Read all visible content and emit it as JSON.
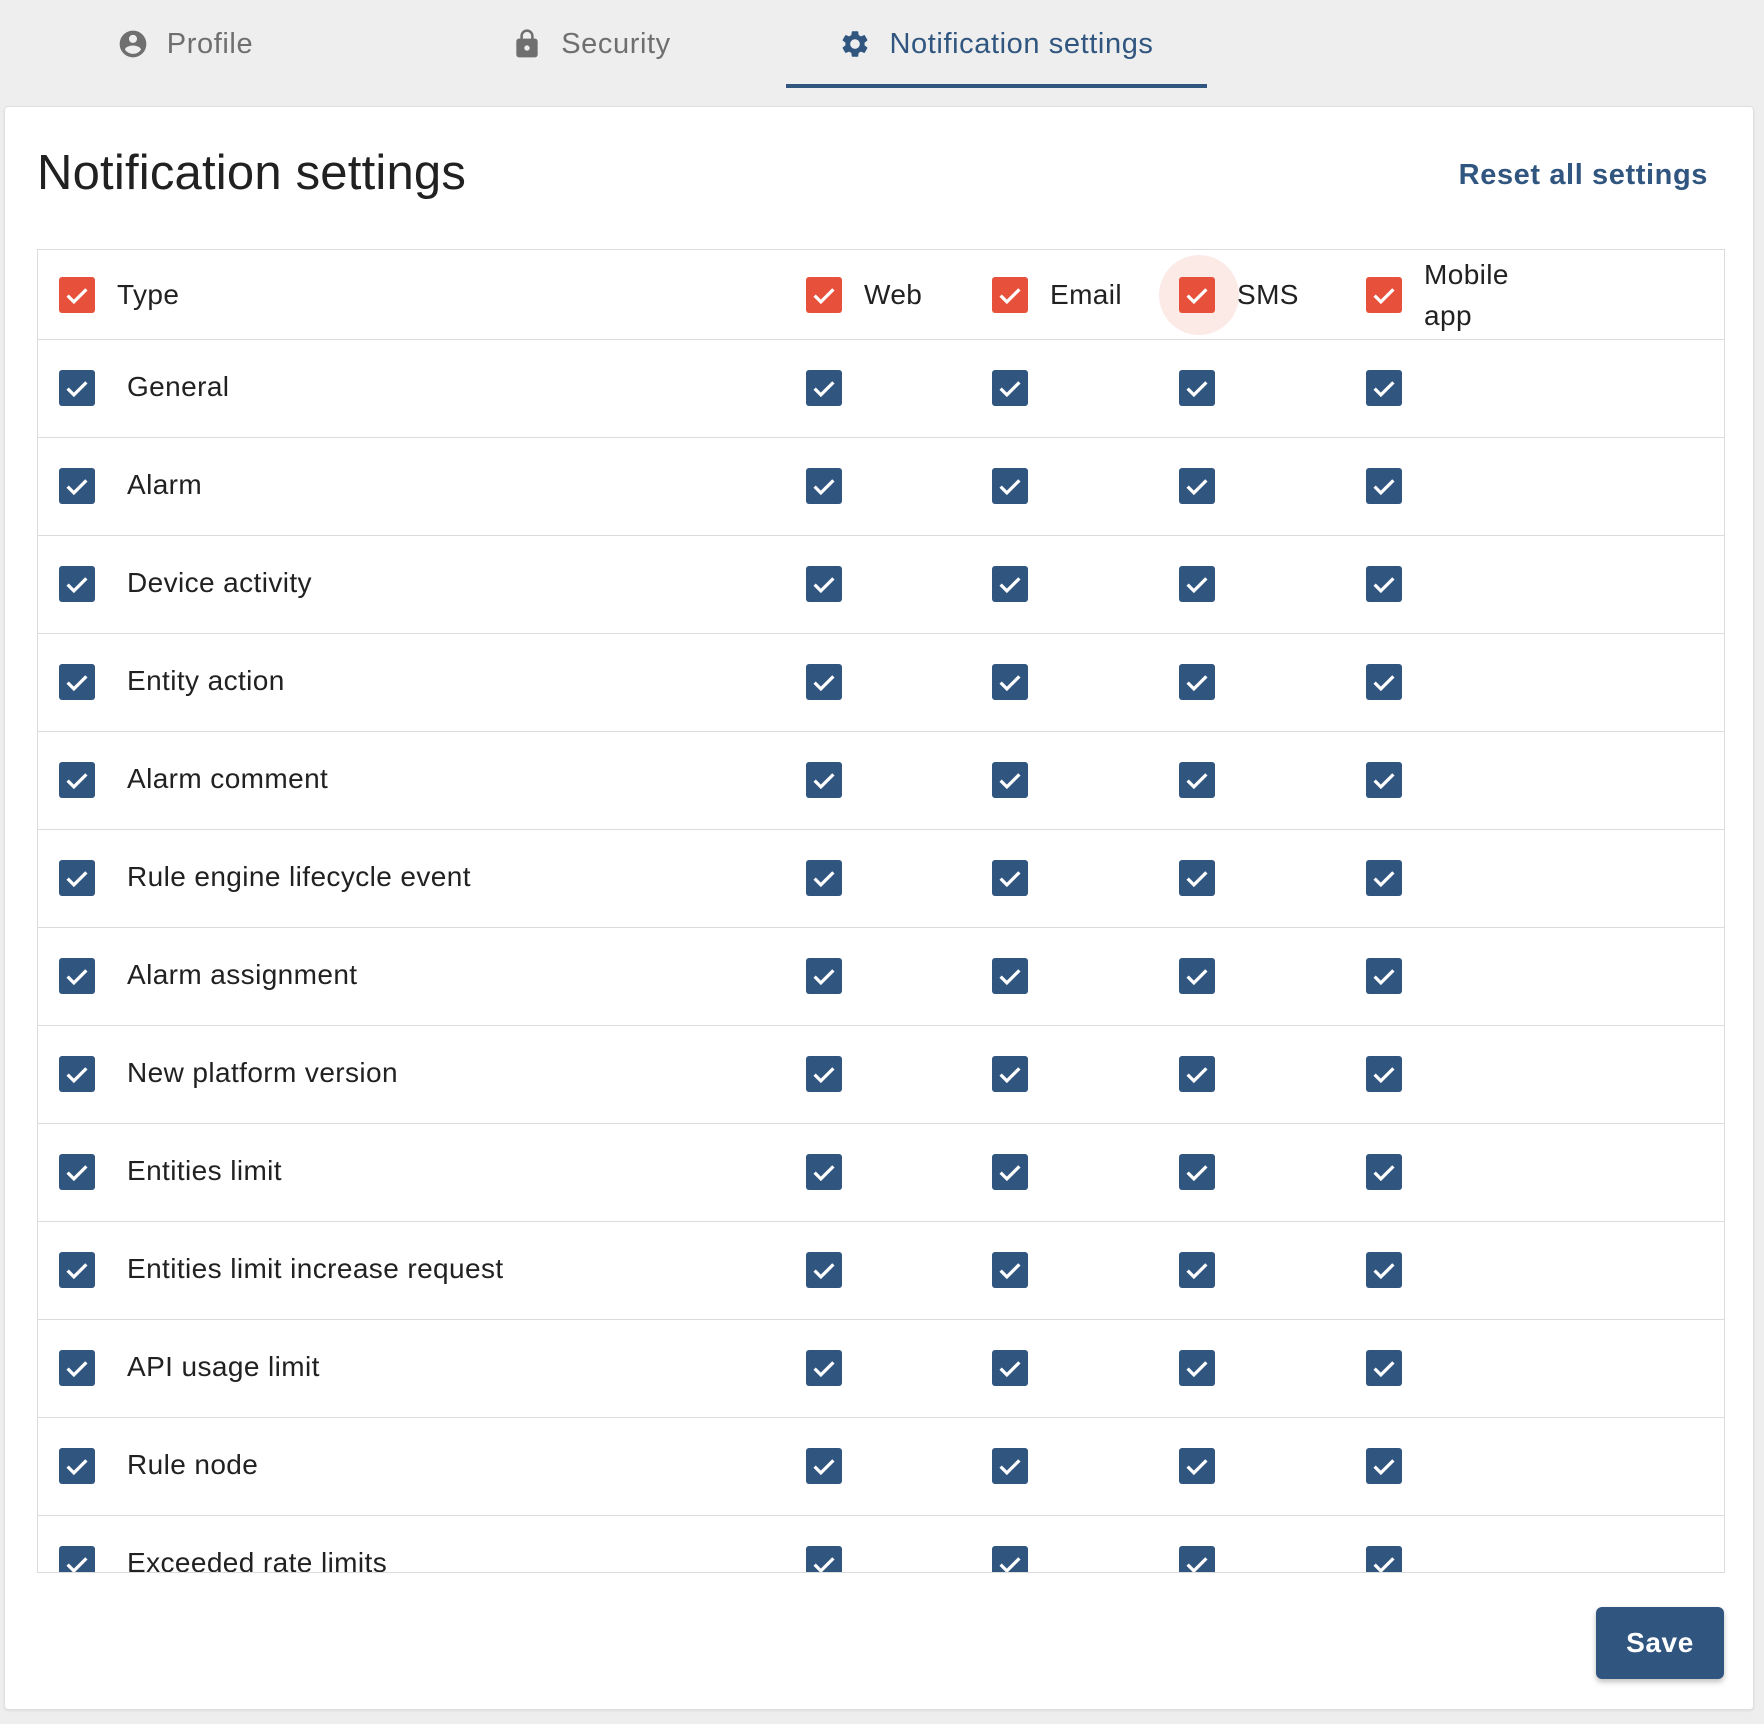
{
  "tabs": [
    {
      "label": "Profile",
      "icon": "account-circle-icon",
      "active": false
    },
    {
      "label": "Security",
      "icon": "lock-icon",
      "active": false
    },
    {
      "label": "Notification settings",
      "icon": "gear-icon",
      "active": true
    }
  ],
  "page": {
    "title": "Notification settings",
    "reset_label": "Reset all settings",
    "save_label": "Save"
  },
  "table": {
    "headers": {
      "type": "Type",
      "web": "Web",
      "email": "Email",
      "sms": "SMS",
      "mobile_line1": "Mobile",
      "mobile_line2": "app"
    },
    "header_checked": true,
    "rows": [
      {
        "label": "General"
      },
      {
        "label": "Alarm"
      },
      {
        "label": "Device activity"
      },
      {
        "label": "Entity action"
      },
      {
        "label": "Alarm comment"
      },
      {
        "label": "Rule engine lifecycle event"
      },
      {
        "label": "Alarm assignment"
      },
      {
        "label": "New platform version"
      },
      {
        "label": "Entities limit"
      },
      {
        "label": "Entities limit increase request"
      },
      {
        "label": "API usage limit"
      },
      {
        "label": "Rule node"
      },
      {
        "label": "Exceeded rate limits"
      }
    ]
  },
  "colors": {
    "primary": "#305680",
    "accent": "#e7513c"
  }
}
